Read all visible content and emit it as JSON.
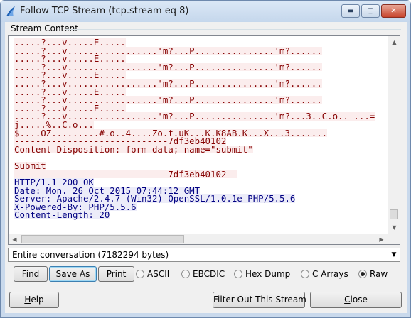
{
  "window": {
    "title": "Follow TCP Stream (tcp.stream eq 8)",
    "min_glyph": "▬",
    "max_glyph": "▢",
    "close_glyph": "✕"
  },
  "stream": {
    "group_label": "Stream Content",
    "lines": [
      {
        "side": "client",
        "text": ".....?...v.....E....."
      },
      {
        "side": "client",
        "text": ".....?...v.................'m?...P...............'m?......"
      },
      {
        "side": "client",
        "text": ".....?...v.....E....."
      },
      {
        "side": "client",
        "text": ".....?...v.................'m?...P...............'m?......"
      },
      {
        "side": "client",
        "text": ".....?...v.....E....."
      },
      {
        "side": "client",
        "text": ".....?...v.................'m?...P...............'m?......"
      },
      {
        "side": "client",
        "text": ".....?...v.....E....."
      },
      {
        "side": "client",
        "text": ".....?...v.................'m?...P...............'m?......"
      },
      {
        "side": "client",
        "text": ".....?...v.....E....."
      },
      {
        "side": "client",
        "text": ".....?...v.................'m?...P...............'m?...3..C.o.._...="
      },
      {
        "side": "client",
        "text": "j.....%..C.o..."
      },
      {
        "side": "client",
        "text": "$....OZ.........#.o..4....Zo.t.uK...K.K8AB.K...X...3......."
      },
      {
        "side": "client",
        "text": "-----------------------------7df3eb40102"
      },
      {
        "side": "client",
        "text": "Content-Disposition: form-data; name=\"submit\""
      },
      {
        "side": "client-plain",
        "text": " "
      },
      {
        "side": "client",
        "text": "Submit"
      },
      {
        "side": "client",
        "text": "-----------------------------7df3eb40102--"
      },
      {
        "side": "server",
        "text": "HTTP/1.1 200 OK"
      },
      {
        "side": "server",
        "text": "Date: Mon, 26 Oct 2015 07:44:12 GMT"
      },
      {
        "side": "server",
        "text": "Server: Apache/2.4.7 (Win32) OpenSSL/1.0.1e PHP/5.5.6"
      },
      {
        "side": "server",
        "text": "X-Powered-By: PHP/5.5.6"
      },
      {
        "side": "server",
        "text": "Content-Length: 20"
      }
    ]
  },
  "scrollbars": {
    "up": "▲",
    "down": "▼",
    "left": "◀",
    "right": "▶",
    "v_grip": "≡",
    "h_grip": "III"
  },
  "conversation_select": {
    "selected": "Entire conversation (7182294 bytes)",
    "arrow": "▼"
  },
  "toolbar": {
    "find_label": "Find",
    "save_as_label": "Save As",
    "print_label": "Print"
  },
  "format": {
    "options": [
      "ASCII",
      "EBCDIC",
      "Hex Dump",
      "C Arrays",
      "Raw"
    ],
    "selected": "Raw"
  },
  "footer": {
    "help_label": "Help",
    "filter_label": "Filter Out This Stream",
    "close_label": "Close"
  },
  "colors": {
    "client_text": "#850000",
    "client_bg": "#fbeded",
    "server_text": "#000082",
    "server_bg": "#ececf9",
    "dialog_bg": "#f0f0f0",
    "title_bar": "#c9d9ec"
  }
}
